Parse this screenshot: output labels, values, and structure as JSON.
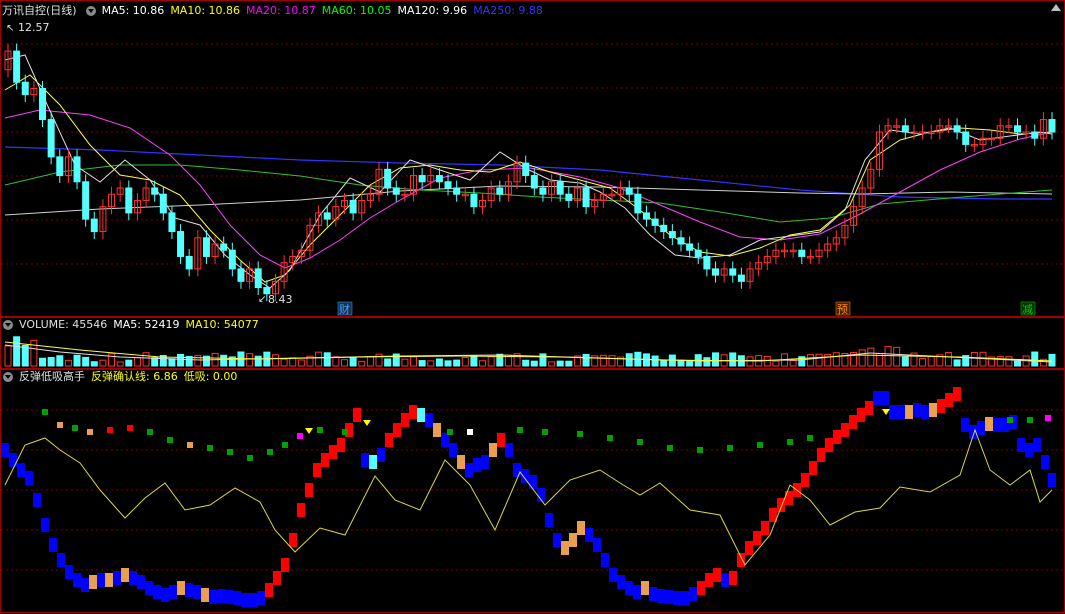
{
  "panel_main": {
    "stock_name": "万讯自控(日线)",
    "indicators": [
      {
        "label": "MA5: 10.86",
        "color": "#ffffff"
      },
      {
        "label": "MA10: 10.86",
        "color": "#ffff00"
      },
      {
        "label": "MA20: 10.87",
        "color": "#ff00ff"
      },
      {
        "label": "MA60: 10.05",
        "color": "#00ff00"
      },
      {
        "label": "MA120: 9.96",
        "color": "#ffffff"
      },
      {
        "label": "MA250: 9.88",
        "color": "#3333ff"
      }
    ],
    "high_label": "12.57",
    "low_label": "8.43",
    "event_markers": [
      {
        "text": "财",
        "color": "#3aa0ff"
      },
      {
        "text": "预",
        "color": "#ff8c00"
      },
      {
        "text": "减",
        "color": "#00d000"
      }
    ]
  },
  "panel_volume": {
    "title": "VOLUME: 45546",
    "ma5": "MA5: 52419",
    "ma10": "MA10: 54077"
  },
  "panel_signal": {
    "title": "反弹低吸高手",
    "confirm": "反弹确认线: 6.86",
    "low_buy": "低吸: 0.00"
  },
  "colors": {
    "up": "#ff3232",
    "down": "#54ffff",
    "grid": "#7a0000",
    "signal_red": "#ff0000",
    "signal_blue": "#0000ff",
    "signal_orange": "#e8a050",
    "signal_green": "#00a000"
  },
  "chart_data": {
    "type": "candlestick",
    "close": [
      12.3,
      11.8,
      11.6,
      11.7,
      11.2,
      10.6,
      10.3,
      10.6,
      10.2,
      9.6,
      9.4,
      9.8,
      10.0,
      10.1,
      9.7,
      9.9,
      10.1,
      10.0,
      9.7,
      9.4,
      9.0,
      8.8,
      9.3,
      9.0,
      9.2,
      9.1,
      8.8,
      8.6,
      8.8,
      8.5,
      8.4,
      8.6,
      8.9,
      9.0,
      9.1,
      9.5,
      9.7,
      9.6,
      9.8,
      9.9,
      9.7,
      9.9,
      10.0,
      10.4,
      10.1,
      10.0,
      10.0,
      10.3,
      10.2,
      10.3,
      10.2,
      10.1,
      10.0,
      10.0,
      9.8,
      9.9,
      10.1,
      10.0,
      10.2,
      10.5,
      10.3,
      10.1,
      10.0,
      10.2,
      10.0,
      9.9,
      10.1,
      9.8,
      9.9,
      10.0,
      10.0,
      10.1,
      10.0,
      9.7,
      9.6,
      9.5,
      9.4,
      9.3,
      9.2,
      9.1,
      9.0,
      8.8,
      8.7,
      8.8,
      8.7,
      8.6,
      8.8,
      8.9,
      9.0,
      9.1,
      9.1,
      9.1,
      9.0,
      9.0,
      9.1,
      9.2,
      9.3,
      9.5,
      9.8,
      10.1,
      10.4,
      11.0,
      11.1,
      11.1,
      11.0,
      11.0,
      11.0,
      11.0,
      11.1,
      11.1,
      11.0,
      10.8,
      10.8,
      10.9,
      10.9,
      11.1,
      11.1,
      11.0,
      11.0,
      10.9,
      11.2,
      11.0
    ],
    "open": [
      12.0,
      12.3,
      11.8,
      11.6,
      11.7,
      11.2,
      10.6,
      10.3,
      10.6,
      10.2,
      9.6,
      9.4,
      9.8,
      10.0,
      10.1,
      9.7,
      9.9,
      10.1,
      10.0,
      9.7,
      9.4,
      9.0,
      8.8,
      9.3,
      9.0,
      9.2,
      9.1,
      8.8,
      8.6,
      8.8,
      8.5,
      8.4,
      8.6,
      8.9,
      9.0,
      9.1,
      9.5,
      9.7,
      9.6,
      9.8,
      9.9,
      9.7,
      9.9,
      10.0,
      10.4,
      10.1,
      10.0,
      10.0,
      10.3,
      10.2,
      10.3,
      10.2,
      10.1,
      10.0,
      10.0,
      9.8,
      9.9,
      10.1,
      10.0,
      10.2,
      10.5,
      10.3,
      10.1,
      10.0,
      10.2,
      10.0,
      9.9,
      10.1,
      9.8,
      9.9,
      10.0,
      10.0,
      10.1,
      10.0,
      9.7,
      9.6,
      9.5,
      9.4,
      9.3,
      9.2,
      9.1,
      9.0,
      8.8,
      8.7,
      8.8,
      8.7,
      8.6,
      8.8,
      8.9,
      9.0,
      9.1,
      9.1,
      9.1,
      9.0,
      9.0,
      9.1,
      9.2,
      9.3,
      9.5,
      9.8,
      10.1,
      10.4,
      11.0,
      11.1,
      11.1,
      11.0,
      11.0,
      11.0,
      11.0,
      11.1,
      11.1,
      11.0,
      10.8,
      10.8,
      10.9,
      10.9,
      11.1,
      11.1,
      11.0,
      11.0,
      10.9,
      11.2
    ],
    "y_range": [
      8.3,
      12.8
    ]
  }
}
